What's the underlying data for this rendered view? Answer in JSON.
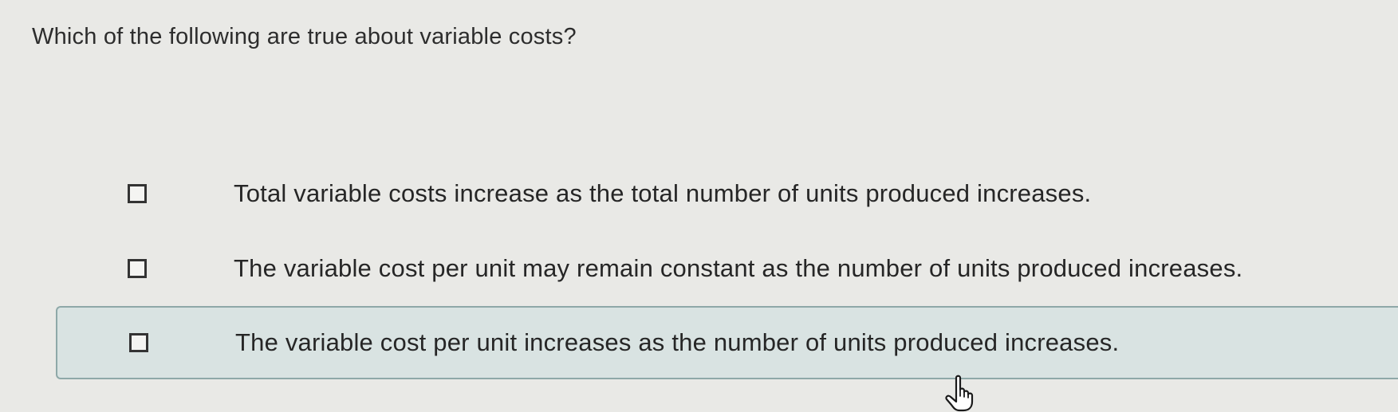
{
  "question": {
    "text": "Which of the following are true about variable costs?"
  },
  "options": [
    {
      "label": "Total variable costs increase as the total number of units produced increases.",
      "checked": false,
      "highlighted": false
    },
    {
      "label": "The variable cost per unit may remain constant as the number of units produced increases.",
      "checked": false,
      "highlighted": false
    },
    {
      "label": "The variable cost per unit increases as the number of units produced increases.",
      "checked": false,
      "highlighted": true
    }
  ],
  "cursor": {
    "icon": "hand-pointer-icon"
  },
  "colors": {
    "background": "#e9e9e6",
    "highlight_fill": "#d9e3e2",
    "highlight_border": "#8ea8a8",
    "text": "#2b2b2b"
  }
}
